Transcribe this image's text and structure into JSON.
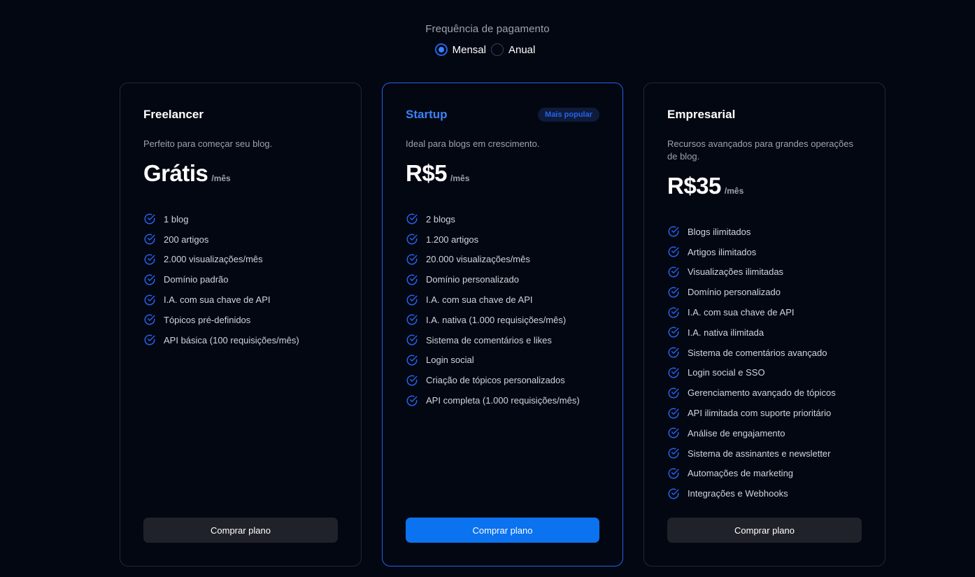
{
  "billing": {
    "label": "Frequência de pagamento",
    "options": [
      {
        "label": "Mensal",
        "checked": true
      },
      {
        "label": "Anual",
        "checked": false
      }
    ]
  },
  "colors": {
    "accent": "#2563eb",
    "background": "#030712",
    "check": "#2563eb"
  },
  "plans": [
    {
      "name": "Freelancer",
      "description": "Perfeito para começar seu blog.",
      "price": "Grátis",
      "period": "/mês",
      "button": "Comprar plano",
      "features": [
        "1 blog",
        "200 artigos",
        "2.000 visualizações/mês",
        "Domínio padrão",
        "I.A. com sua chave de API",
        "Tópicos pré-definidos",
        "API básica (100 requisições/mês)"
      ]
    },
    {
      "name": "Startup",
      "badge": "Mais popular",
      "description": "Ideal para blogs em crescimento.",
      "price": "R$5",
      "period": "/mês",
      "button": "Comprar plano",
      "features": [
        "2 blogs",
        "1.200 artigos",
        "20.000 visualizações/mês",
        "Domínio personalizado",
        "I.A. com sua chave de API",
        "I.A. nativa (1.000 requisições/mês)",
        "Sistema de comentários e likes",
        "Login social",
        "Criação de tópicos personalizados",
        "API completa (1.000 requisições/mês)"
      ]
    },
    {
      "name": "Empresarial",
      "description": "Recursos avançados para grandes operações de blog.",
      "price": "R$35",
      "period": "/mês",
      "button": "Comprar plano",
      "features": [
        "Blogs ilimitados",
        "Artigos ilimitados",
        "Visualizações ilimitadas",
        "Domínio personalizado",
        "I.A. com sua chave de API",
        "I.A. nativa ilimitada",
        "Sistema de comentários avançado",
        "Login social e SSO",
        "Gerenciamento avançado de tópicos",
        "API ilimitada com suporte prioritário",
        "Análise de engajamento",
        "Sistema de assinantes e newsletter",
        "Automações de marketing",
        "Integrações e Webhooks"
      ]
    }
  ]
}
